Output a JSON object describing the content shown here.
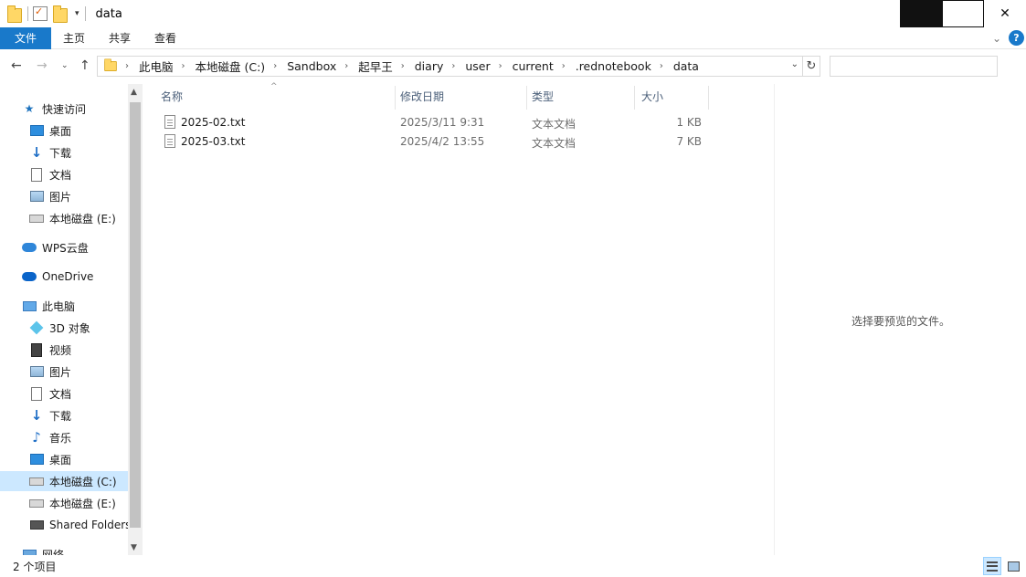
{
  "window": {
    "title": "data"
  },
  "ribbon": {
    "file": "文件",
    "home": "主页",
    "share": "共享",
    "view": "查看"
  },
  "address": {
    "crumbs": [
      "此电脑",
      "本地磁盘 (C:)",
      "Sandbox",
      "起早王",
      "diary",
      "user",
      "current",
      ".rednotebook",
      "data"
    ]
  },
  "nav": {
    "quick_access": "快速访问",
    "quick_items": [
      {
        "label": "桌面",
        "icon": "desktop-icon",
        "pinned": true
      },
      {
        "label": "下载",
        "icon": "download-icon",
        "pinned": true
      },
      {
        "label": "文档",
        "icon": "document-icon",
        "pinned": true
      },
      {
        "label": "图片",
        "icon": "pictures-icon",
        "pinned": true
      },
      {
        "label": "本地磁盘 (E:)",
        "icon": "drive-icon",
        "pinned": false
      }
    ],
    "wps": "WPS云盘",
    "onedrive": "OneDrive",
    "this_pc": "此电脑",
    "pc_items": [
      {
        "label": "3D 对象",
        "icon": "3d-objects-icon"
      },
      {
        "label": "视频",
        "icon": "videos-icon"
      },
      {
        "label": "图片",
        "icon": "pictures-icon"
      },
      {
        "label": "文档",
        "icon": "document-icon"
      },
      {
        "label": "下载",
        "icon": "download-icon"
      },
      {
        "label": "音乐",
        "icon": "music-icon"
      },
      {
        "label": "桌面",
        "icon": "desktop-icon"
      },
      {
        "label": "本地磁盘 (C:)",
        "icon": "drive-icon",
        "selected": true
      },
      {
        "label": "本地磁盘 (E:)",
        "icon": "drive-icon"
      },
      {
        "label": "Shared Folders",
        "icon": "shared-folders-icon"
      }
    ],
    "network": "网络"
  },
  "columns": {
    "name": "名称",
    "modified": "修改日期",
    "type": "类型",
    "size": "大小"
  },
  "files": [
    {
      "name": "2025-02.txt",
      "modified": "2025/3/11 9:31",
      "type": "文本文档",
      "size": "1 KB"
    },
    {
      "name": "2025-03.txt",
      "modified": "2025/4/2 13:55",
      "type": "文本文档",
      "size": "7 KB"
    }
  ],
  "preview": {
    "message": "选择要预览的文件。"
  },
  "status": {
    "count": "2 个项目"
  }
}
